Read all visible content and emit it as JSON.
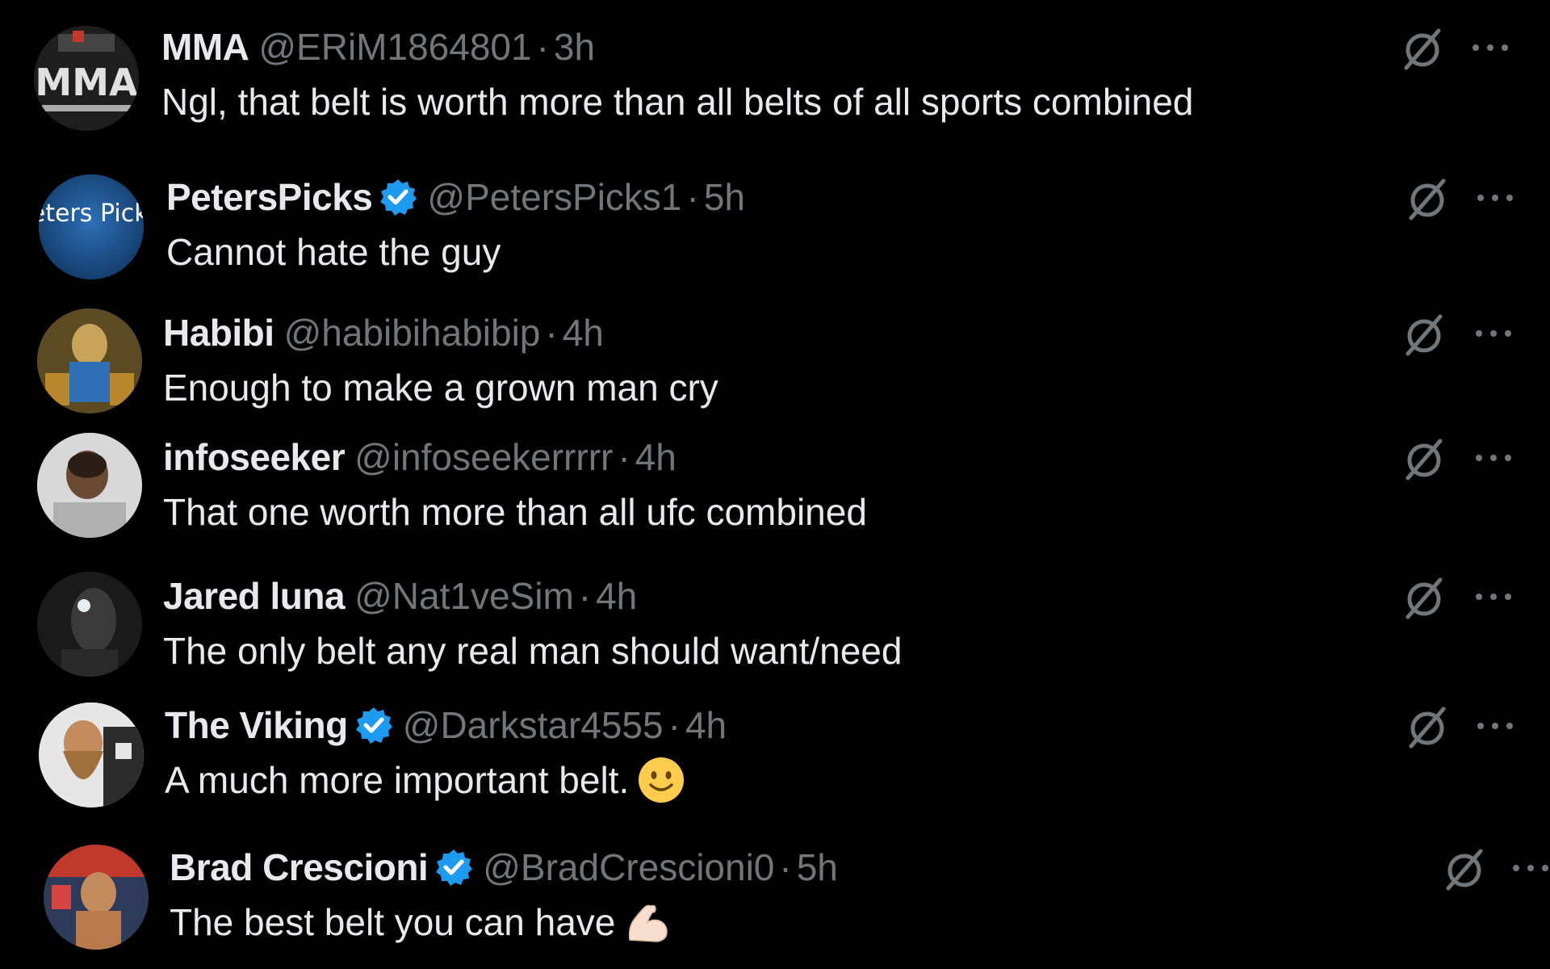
{
  "colors": {
    "background": "#000000",
    "primary_text": "#e7e9ea",
    "secondary_text": "#71767b",
    "verified_blue": "#1d9bf0"
  },
  "icons": {
    "grok": "grok-slash-circle-icon",
    "more": "more-dots-icon",
    "verified": "verified-badge-icon"
  },
  "replies": [
    {
      "name": "MMA",
      "handle": "@ERiM1864801",
      "separator": "·",
      "time": "3h",
      "verified": false,
      "text": "Ngl, that belt is worth more than all belts of all sports combined"
    },
    {
      "name": "PetersPicks",
      "handle": "@PetersPicks1",
      "separator": "·",
      "time": "5h",
      "verified": true,
      "avatar_text": "Peters Picks",
      "text": "Cannot hate the guy"
    },
    {
      "name": "Habibi",
      "handle": "@habibihabibip",
      "separator": "·",
      "time": "4h",
      "verified": false,
      "text": "Enough to make a grown man cry"
    },
    {
      "name": "infoseeker",
      "handle": "@infoseekerrrrr",
      "separator": "·",
      "time": "4h",
      "verified": false,
      "text": "That one worth more than all ufc combined"
    },
    {
      "name": "Jared luna",
      "handle": "@Nat1veSim",
      "separator": "·",
      "time": "4h",
      "verified": false,
      "text": "The only belt any real man should want/need"
    },
    {
      "name": "The Viking",
      "handle": "@Darkstar4555",
      "separator": "·",
      "time": "4h",
      "verified": true,
      "text": "A much more important belt.",
      "emoji": "slightly-smiling-face"
    },
    {
      "name": "Brad Crescioni",
      "handle": "@BradCrescioni0",
      "separator": "·",
      "time": "5h",
      "verified": true,
      "text": "The best belt you can have",
      "emoji": "flexed-biceps"
    }
  ]
}
